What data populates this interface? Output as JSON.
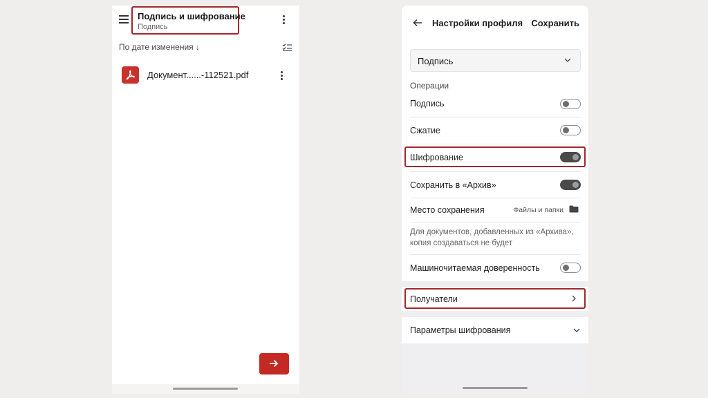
{
  "left_screen": {
    "header": {
      "title": "Подпись и шифрование",
      "subtitle": "Подпись"
    },
    "sort": {
      "label": "По дате изменения ↓"
    },
    "documents": [
      {
        "name": "Документ......-112521.pdf",
        "icon": "pdf-icon"
      }
    ],
    "fab": {
      "icon": "arrow-right-icon"
    }
  },
  "right_screen": {
    "header": {
      "title": "Настройки профиля",
      "save_label": "Сохранить"
    },
    "profile_select": {
      "value": "Подпись"
    },
    "operations_label": "Операции",
    "toggles": [
      {
        "label": "Подпись",
        "on": false
      },
      {
        "label": "Сжатие",
        "on": false
      },
      {
        "label": "Шифрование",
        "on": true
      },
      {
        "label": "Сохранить в «Архив»",
        "on": true
      }
    ],
    "save_place": {
      "label": "Место сохранения",
      "value": "Файлы и папки"
    },
    "note": "Для документов, добавленных из «Архива», копия создаваться не будет",
    "machine_readable": {
      "label": "Машиночитаемая доверенность",
      "on": false
    },
    "recipients_label": "Получатели",
    "encryption_params_label": "Параметры шифрования"
  },
  "colors": {
    "highlight": "#a3262a",
    "accent_red": "#c42a24",
    "toggle_on": "#4a4a4a",
    "background": "#f0eeec"
  }
}
